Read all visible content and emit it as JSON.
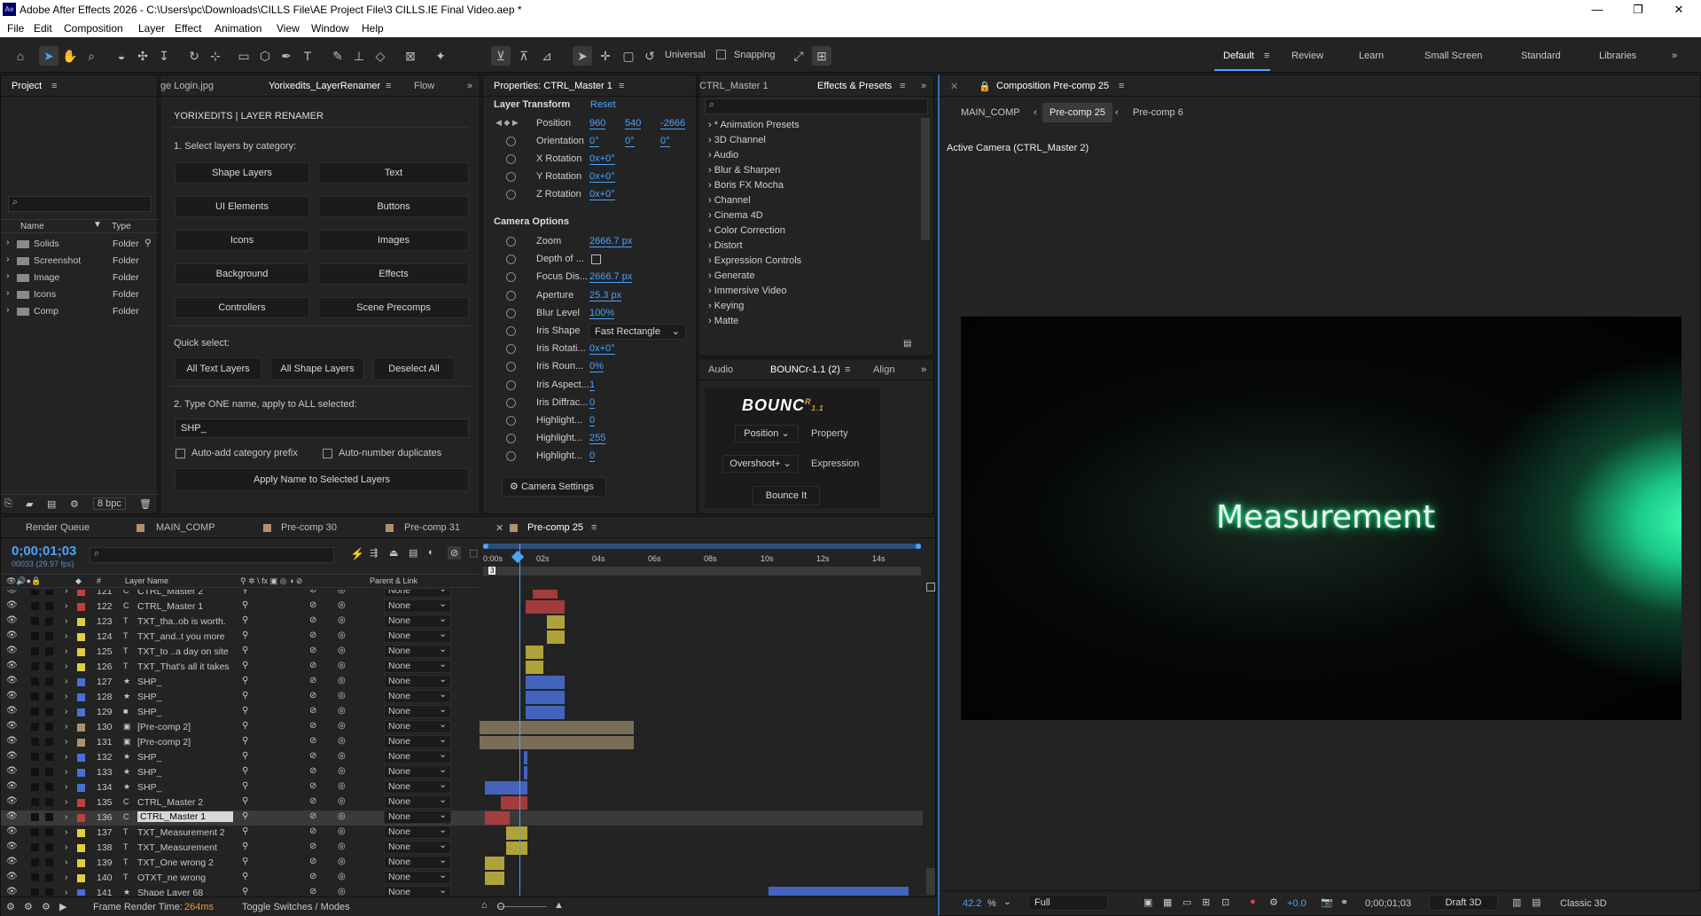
{
  "window": {
    "title": "Adobe After Effects 2026 - C:\\Users\\pc\\Downloads\\CILLS File\\AE Project File\\3 CILLS.IE Final Video.aep *",
    "app_icon": "Ae"
  },
  "menu": [
    "File",
    "Edit",
    "Composition",
    "Layer",
    "Effect",
    "Animation",
    "View",
    "Window",
    "Help"
  ],
  "toolbar": {
    "axis_mode": "Universal",
    "snapping": "Snapping"
  },
  "workspaces": [
    "Default",
    "Review",
    "Learn",
    "Small Screen",
    "Standard",
    "Libraries"
  ],
  "project": {
    "tab": "Project",
    "columns": [
      "Name",
      "Type"
    ],
    "items": [
      {
        "name": "Solids",
        "type": "Folder"
      },
      {
        "name": "Screenshot",
        "type": "Folder"
      },
      {
        "name": "Image",
        "type": "Folder"
      },
      {
        "name": "Icons",
        "type": "Folder"
      },
      {
        "name": "Comp",
        "type": "Folder"
      }
    ],
    "bpc": "8 bpc"
  },
  "renamer": {
    "tabs": [
      "ge Login.jpg",
      "Yorixedits_LayerRenamer",
      "Flow"
    ],
    "header": "YORIXEDITS  |  LAYER RENAMER",
    "step1": "1. Select layers by category:",
    "categories": [
      "Shape Layers",
      "Text",
      "UI Elements",
      "Buttons",
      "Icons",
      "Images",
      "Background",
      "Effects",
      "Controllers",
      "Scene Precomps"
    ],
    "quick_label": "Quick select:",
    "quick": [
      "All Text Layers",
      "All Shape Layers",
      "Deselect All"
    ],
    "step2": "2. Type ONE name, apply to ALL selected:",
    "name_value": "SHP_",
    "opt1": "Auto-add category prefix",
    "opt2": "Auto-number duplicates",
    "apply": "Apply Name to Selected Layers"
  },
  "properties": {
    "tab": "Properties: CTRL_Master 1",
    "section1": "Layer Transform",
    "reset": "Reset",
    "position": {
      "label": "Position",
      "x": "960",
      "y": "540",
      "z": "-2666"
    },
    "orientation": {
      "label": "Orientation",
      "x": "0°",
      "y": "0°",
      "z": "0°"
    },
    "rotations": [
      {
        "label": "X Rotation",
        "value": "0x+0°"
      },
      {
        "label": "Y Rotation",
        "value": "0x+0°"
      },
      {
        "label": "Z Rotation",
        "value": "0x+0°"
      }
    ],
    "section2": "Camera Options",
    "camera": [
      {
        "label": "Zoom",
        "value": "2666.7 px"
      },
      {
        "label": "Depth of ...",
        "value": ""
      },
      {
        "label": "Focus Dis...",
        "value": "2666.7 px"
      },
      {
        "label": "Aperture",
        "value": "25.3 px"
      },
      {
        "label": "Blur Level",
        "value": "100%"
      },
      {
        "label": "Iris Shape",
        "value": "Fast Rectangle"
      },
      {
        "label": "Iris Rotati...",
        "value": "0x+0°"
      },
      {
        "label": "Iris Roun...",
        "value": "0%"
      },
      {
        "label": "Iris Aspect...",
        "value": "1"
      },
      {
        "label": "Iris Diffrac...",
        "value": "0"
      },
      {
        "label": "Highlight...",
        "value": "0"
      },
      {
        "label": "Highlight...",
        "value": "255"
      },
      {
        "label": "Highlight...",
        "value": "0"
      }
    ],
    "camera_settings": "Camera Settings"
  },
  "effects": {
    "tabs": [
      "CTRL_Master 1",
      "Effects & Presets"
    ],
    "items": [
      "* Animation Presets",
      "3D Channel",
      "Audio",
      "Blur & Sharpen",
      "Boris FX Mocha",
      "Channel",
      "Cinema 4D",
      "Color Correction",
      "Distort",
      "Expression Controls",
      "Generate",
      "Immersive Video",
      "Keying",
      "Matte"
    ]
  },
  "bouncr": {
    "tabs": [
      "Audio",
      "BOUNCr-1.1 (2)",
      "Align"
    ],
    "logo": "BOUNC",
    "logo_sup": "R",
    "logo_ver": "1.1",
    "property_select": "Position",
    "property_label": "Property",
    "expression_select": "Overshoot+",
    "expression_label": "Expression",
    "button": "Bounce It"
  },
  "composition": {
    "tab": "Composition Pre-comp 25",
    "breadcrumbs": [
      "MAIN_COMP",
      "Pre-comp 25",
      "Pre-comp 6"
    ],
    "camera_label": "Active Camera (CTRL_Master 2)",
    "viewer_text": "Measurement",
    "zoom": "42.2",
    "zoom_unit": "%",
    "resolution": "Full",
    "exposure": "+0.0",
    "timecode": "0;00;01;03",
    "renderer": "Draft 3D",
    "mode": "Classic 3D"
  },
  "timeline": {
    "tabs": [
      "Render Queue",
      "MAIN_COMP",
      "Pre-comp 30",
      "Pre-comp 31",
      "Pre-comp 25"
    ],
    "timecode": "0;00;01;03",
    "frames": "00033 (29.97 fps)",
    "columns": {
      "num": "#",
      "name": "Layer Name",
      "parent": "Parent & Link"
    },
    "ruler": [
      "0:00s",
      "02s",
      "04s",
      "06s",
      "08s",
      "10s",
      "12s",
      "14s"
    ],
    "marker": "3",
    "layers": [
      {
        "num": "121",
        "name": "CTRL_Master 2",
        "icon": "C",
        "color": "#c04040"
      },
      {
        "num": "122",
        "name": "CTRL_Master 1",
        "icon": "C",
        "color": "#c04040"
      },
      {
        "num": "123",
        "name": "TXT_tha..ob is worth.",
        "icon": "T",
        "color": "#e0d040"
      },
      {
        "num": "124",
        "name": "TXT_and..t you more",
        "icon": "T",
        "color": "#e0d040"
      },
      {
        "num": "125",
        "name": "TXT_to ..a day on site",
        "icon": "T",
        "color": "#e0d040"
      },
      {
        "num": "126",
        "name": "TXT_That's all it takes",
        "icon": "T",
        "color": "#e0d040"
      },
      {
        "num": "127",
        "name": "SHP_",
        "icon": "★",
        "color": "#4a6fd8"
      },
      {
        "num": "128",
        "name": "SHP_",
        "icon": "★",
        "color": "#4a6fd8"
      },
      {
        "num": "129",
        "name": "SHP_",
        "icon": "■",
        "color": "#4a6fd8"
      },
      {
        "num": "130",
        "name": "[Pre-comp 2]",
        "icon": "▣",
        "color": "#b09070"
      },
      {
        "num": "131",
        "name": "[Pre-comp 2]",
        "icon": "▣",
        "color": "#b09070"
      },
      {
        "num": "132",
        "name": "SHP_",
        "icon": "★",
        "color": "#4a6fd8"
      },
      {
        "num": "133",
        "name": "SHP_",
        "icon": "★",
        "color": "#4a6fd8"
      },
      {
        "num": "134",
        "name": "SHP_",
        "icon": "★",
        "color": "#4a6fd8"
      },
      {
        "num": "135",
        "name": "CTRL_Master 2",
        "icon": "C",
        "color": "#c04040"
      },
      {
        "num": "136",
        "name": "CTRL_Master 1",
        "icon": "C",
        "color": "#c04040"
      },
      {
        "num": "137",
        "name": "TXT_Measurement 2",
        "icon": "T",
        "color": "#e0d040"
      },
      {
        "num": "138",
        "name": "TXT_Measurement",
        "icon": "T",
        "color": "#e0d040"
      },
      {
        "num": "139",
        "name": "TXT_One wrong 2",
        "icon": "T",
        "color": "#e0d040"
      },
      {
        "num": "140",
        "name": "OTXT_ne wrong",
        "icon": "T",
        "color": "#e0d040"
      },
      {
        "num": "141",
        "name": "Shape Layer 68",
        "icon": "★",
        "color": "#4a6fd8"
      }
    ],
    "parent_value": "None",
    "footer": {
      "label": "Frame Render Time:",
      "value": "264ms",
      "toggle": "Toggle Switches / Modes"
    }
  }
}
